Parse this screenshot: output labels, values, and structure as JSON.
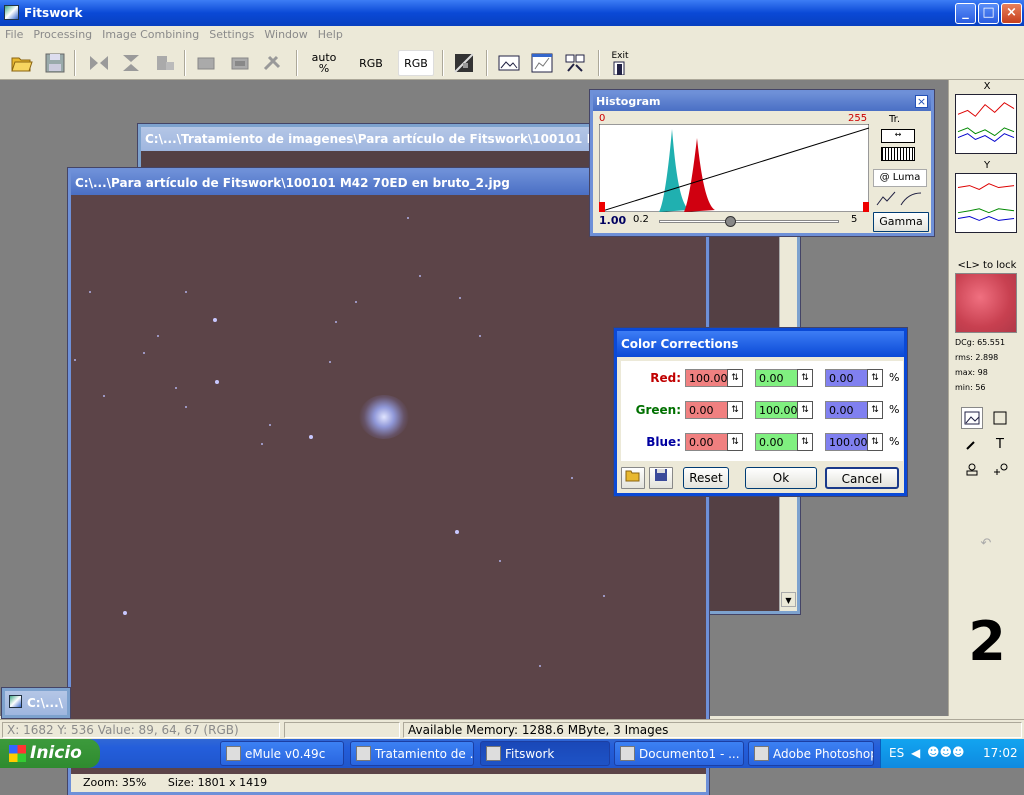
{
  "app": {
    "title": "Fitswork"
  },
  "window_controls": {
    "minimize": "_",
    "maximize": "□",
    "close": "×"
  },
  "menu": [
    "File",
    "Processing",
    "Image Combining",
    "Settings",
    "Window",
    "Help"
  ],
  "toolbar": {
    "auto_label_1": "auto",
    "auto_label_2": "%",
    "rgb1": "RGB",
    "rgb2": "RGB",
    "exit": "Exit"
  },
  "back_window": {
    "title": "C:\\...\\Tratamiento de imagenes\\Para artículo de Fitswork\\100101 M42 7"
  },
  "main_window": {
    "title": "C:\\...\\Para artículo de Fitswork\\100101 M42 70ED en bruto_2.jpg",
    "zoom": "Zoom: 35%",
    "size": "Size: 1801 x 1419"
  },
  "min_window": {
    "title": "C:\\...\\"
  },
  "histogram": {
    "title": "Histogram",
    "left_val": "0",
    "right_val": "255",
    "tr": "Tr.",
    "luma": "@ Luma",
    "gamma_btn": "Gamma",
    "gamma_val": "1.00",
    "slider_min": "0.2",
    "slider_max": "5",
    "slider_value": 2.1
  },
  "color_corrections": {
    "title": "Color Corrections",
    "rows": [
      {
        "label": "Red:",
        "label_color": "#c00000",
        "values": [
          "100.00",
          "0.00",
          "0.00"
        ]
      },
      {
        "label": "Green:",
        "label_color": "#007000",
        "values": [
          "0.00",
          "100.00",
          "0.00"
        ]
      },
      {
        "label": "Blue:",
        "label_color": "#0000a0",
        "values": [
          "0.00",
          "0.00",
          "100.00"
        ]
      }
    ],
    "pct": "%",
    "reset": "Reset",
    "ok": "Ok",
    "cancel": "Cancel"
  },
  "right_panel": {
    "x_label": "X",
    "y_label": "Y",
    "lock_label": "<L> to lock",
    "dcg": "DCg: 65.551",
    "rms": "rms: 2.898",
    "max": "max: 98",
    "min": "min: 56",
    "big_number": "2",
    "tool_text": "T"
  },
  "status": {
    "coords": "X: 1682  Y: 536  Value: 89, 64, 67 (RGB)",
    "memory": "Available Memory: 1288.6 MByte, 3 Images"
  },
  "taskbar": {
    "start": "Inicio",
    "tasks": [
      "eMule v0.49c",
      "Tratamiento de ...",
      "Fitswork",
      "Documento1 - ...",
      "Adobe Photoshop"
    ],
    "lang": "ES",
    "time": "17:02"
  }
}
